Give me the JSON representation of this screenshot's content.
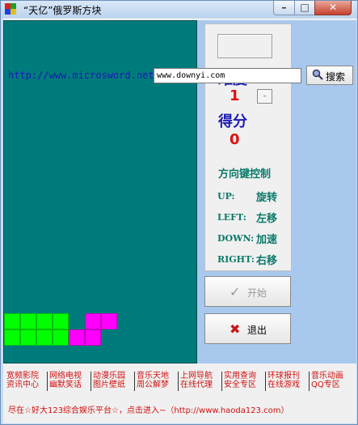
{
  "window": {
    "title": "“天亿”俄罗斯方块"
  },
  "panel": {
    "difficulty_label": "难度",
    "difficulty_value": "1",
    "inc_label": "+",
    "dec_label": "-",
    "score_label": "得分",
    "score_value": "0",
    "controls_title": "方向键控制",
    "controls": [
      {
        "key": "UP:",
        "action": "旋转"
      },
      {
        "key": "LEFT:",
        "action": "左移"
      },
      {
        "key": "DOWN:",
        "action": "加速"
      },
      {
        "key": "RIGHT:",
        "action": "右移"
      }
    ]
  },
  "buttons": {
    "start": "开始",
    "exit": "退出"
  },
  "links": [
    [
      "宽频影院",
      "资讯中心"
    ],
    [
      "网络电视",
      "幽默笑话"
    ],
    [
      "动漫乐园",
      "图片壁纸"
    ],
    [
      "音乐天地",
      "周公解梦"
    ],
    [
      "上网导航",
      "在线代理"
    ],
    [
      "实用查询",
      "安全专区"
    ],
    [
      "环球报刊",
      "在线游戏"
    ],
    [
      "音乐动画",
      "QQ专区"
    ]
  ],
  "promo": "尽在☆好大123综合娱乐平台☆，点击进入~（http://www.haoda123.com）",
  "site_url": "http://www.microsword.net",
  "search": {
    "value": "www.downyi.com",
    "button": "搜索"
  },
  "colors": {
    "board": "#007b7b",
    "block_green": "#00ff00",
    "block_magenta": "#ff00ff",
    "accent_red": "#e01010"
  }
}
